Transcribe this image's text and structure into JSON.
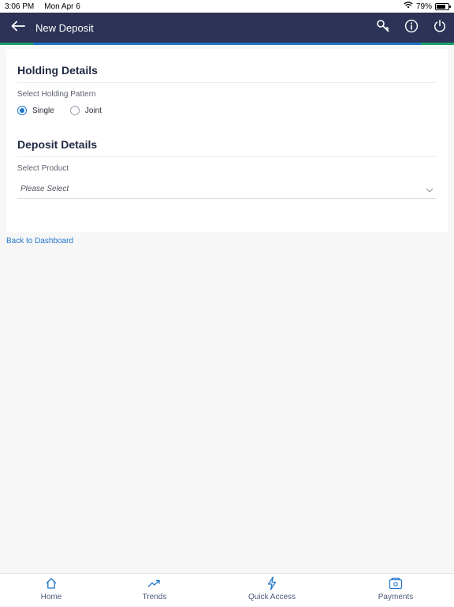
{
  "status_bar": {
    "time": "3:06 PM",
    "date": "Mon Apr 6",
    "battery": "79%",
    "battery_level": 0.79
  },
  "header": {
    "title": "New Deposit",
    "icons": [
      "back-arrow-icon",
      "search-key-icon",
      "info-icon",
      "power-icon"
    ]
  },
  "colors": {
    "header_bg": "#2c3356",
    "accent_blue": "#1f74c9",
    "accent_green": "#1aa36a"
  },
  "holding": {
    "title": "Holding Details",
    "label": "Select Holding Pattern",
    "options": [
      {
        "label": "Single",
        "checked": true
      },
      {
        "label": "Joint",
        "checked": false
      }
    ]
  },
  "deposit": {
    "title": "Deposit Details",
    "label": "Select Product",
    "placeholder": "Please Select"
  },
  "back_link": "Back to Dashboard",
  "tabs": [
    {
      "label": "Home",
      "icon": "home-icon"
    },
    {
      "label": "Trends",
      "icon": "trends-icon"
    },
    {
      "label": "Quick Access",
      "icon": "lightning-icon"
    },
    {
      "label": "Payments",
      "icon": "payments-icon"
    }
  ]
}
